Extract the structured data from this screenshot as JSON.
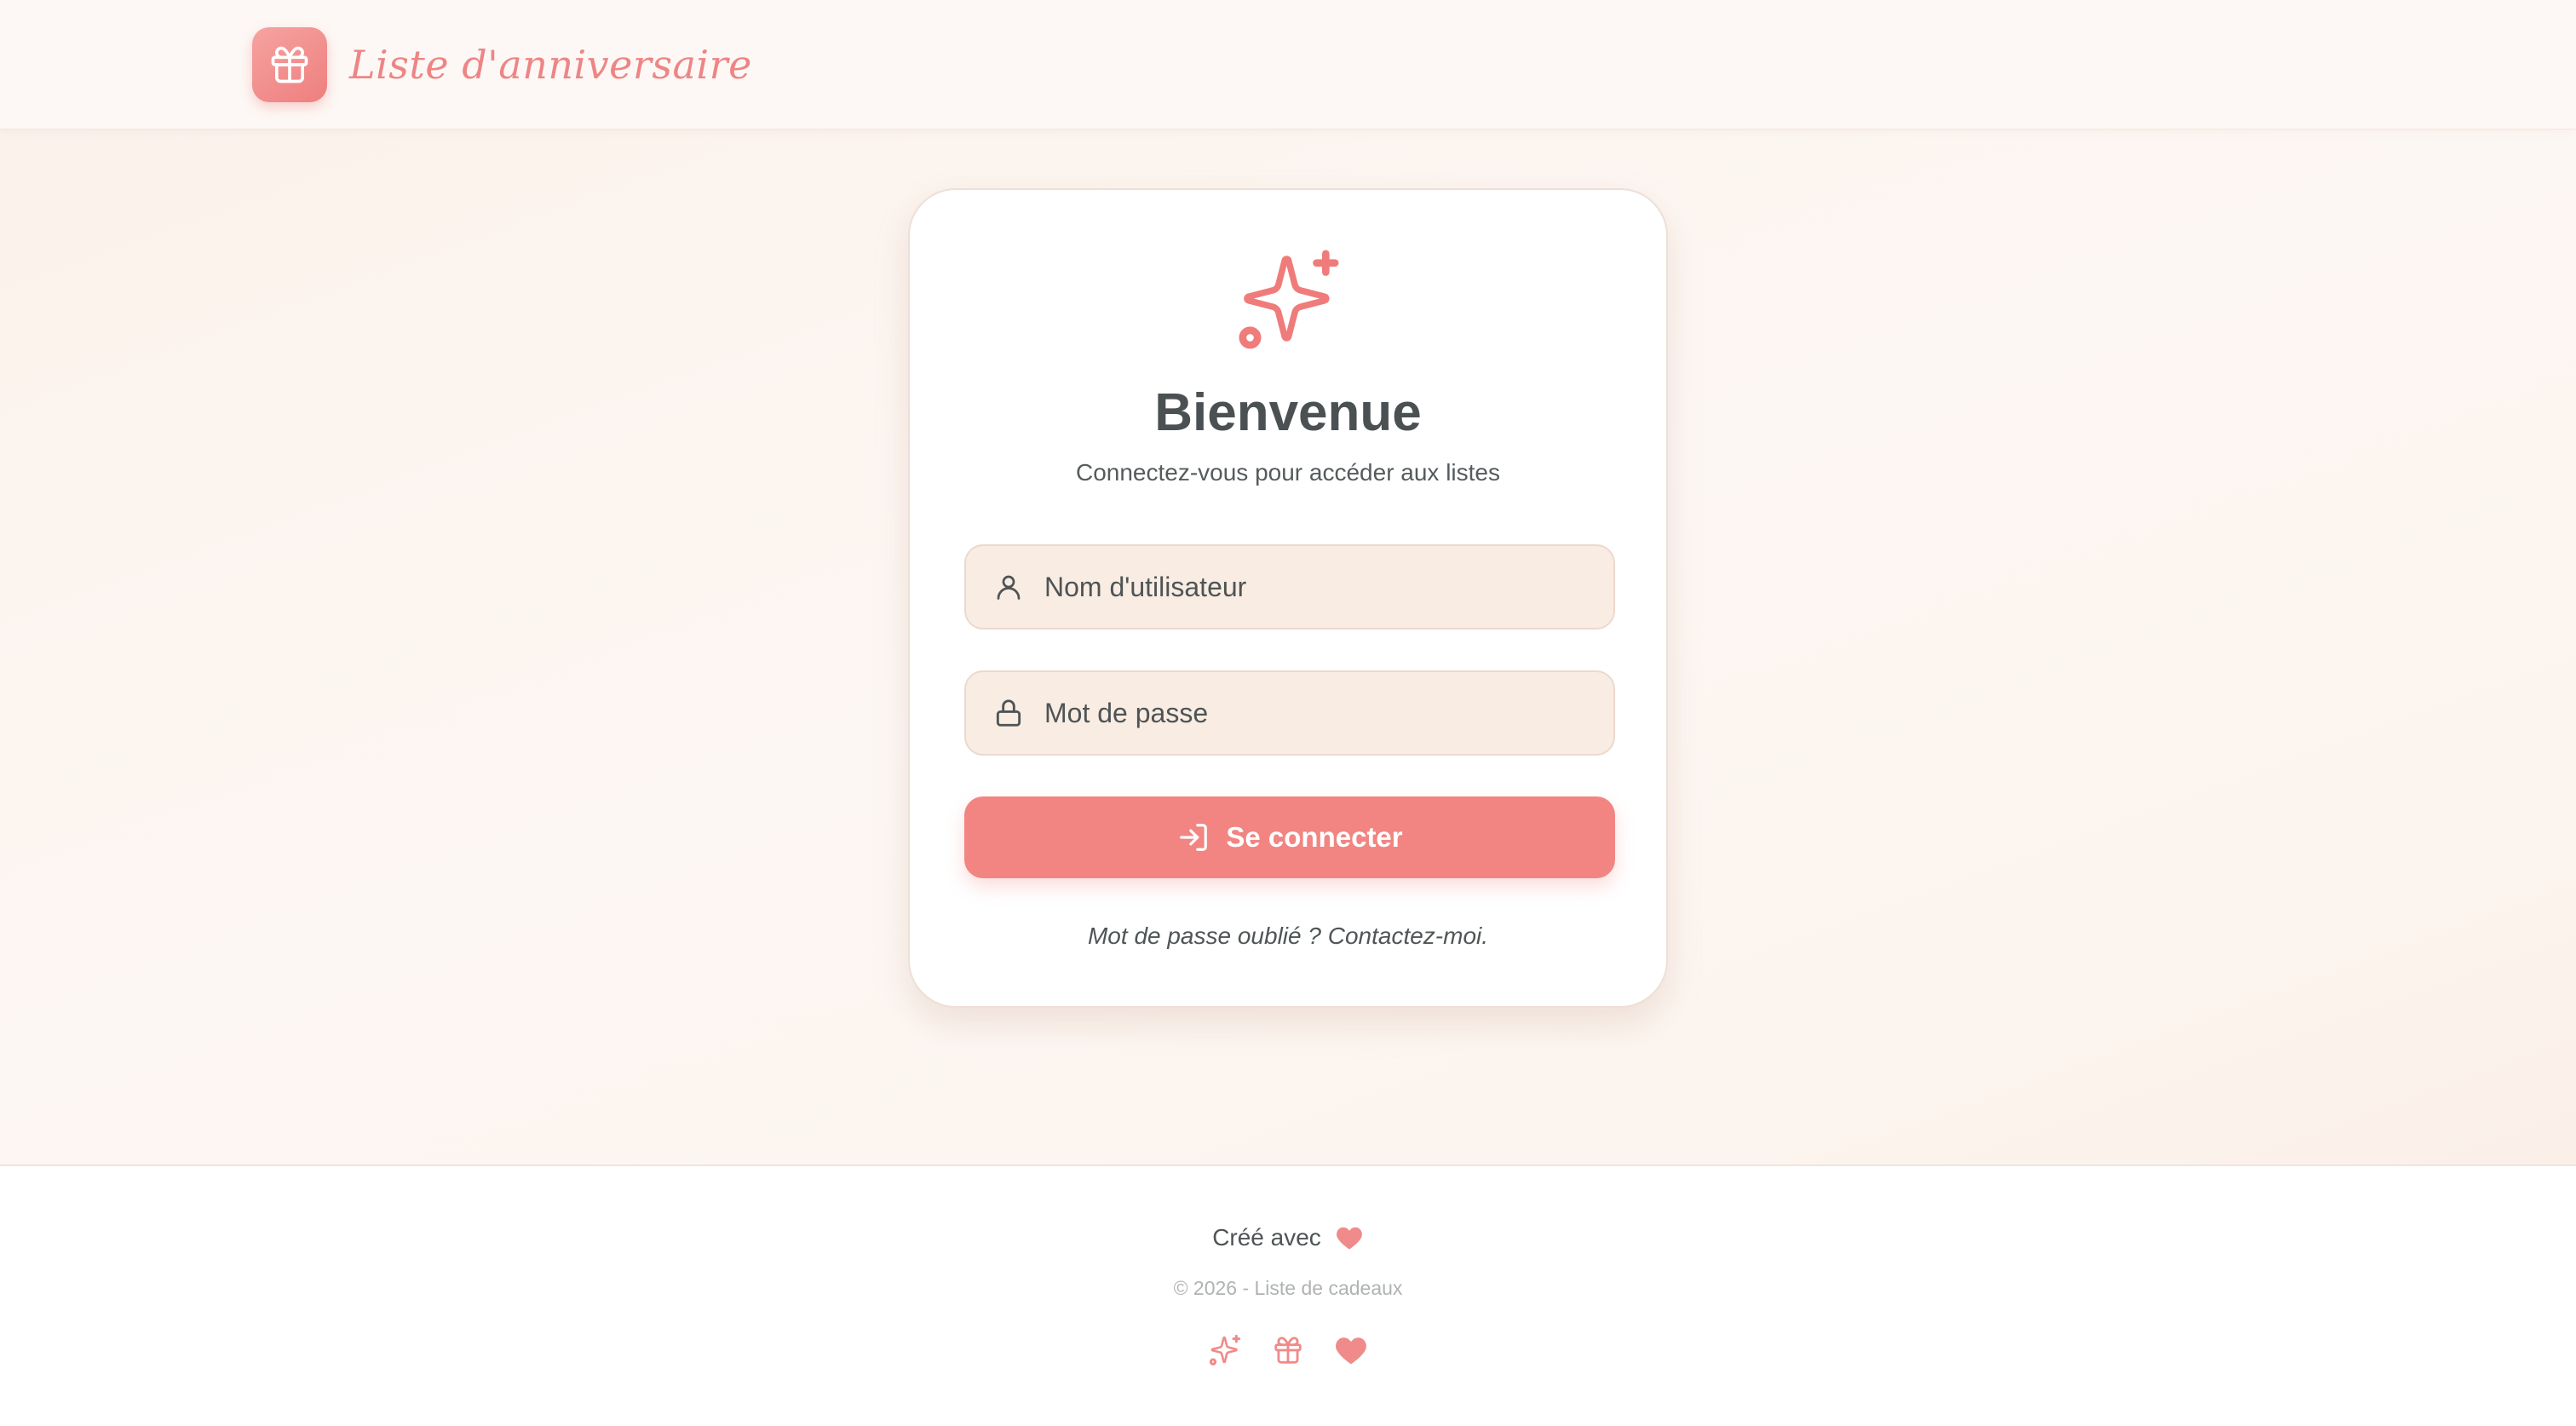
{
  "app": {
    "title": "Liste d'anniversaire",
    "logo_icon": "gift-icon",
    "accent_color": "#f28582"
  },
  "login": {
    "icon": "sparkles-icon",
    "title": "Bienvenue",
    "subtitle": "Connectez-vous pour accéder aux listes",
    "username": {
      "placeholder": "Nom d'utilisateur",
      "value": "",
      "icon": "user-icon"
    },
    "password": {
      "placeholder": "Mot de passe",
      "value": "",
      "icon": "lock-icon"
    },
    "submit_label": "Se connecter",
    "submit_icon": "login-icon",
    "forgot_text": "Mot de passe oublié ? Contactez-moi."
  },
  "footer": {
    "made_with": "Créé avec",
    "copyright": "© 2026 - Liste de cadeaux",
    "icons": [
      "sparkles-icon",
      "gift-icon",
      "heart-icon"
    ]
  }
}
